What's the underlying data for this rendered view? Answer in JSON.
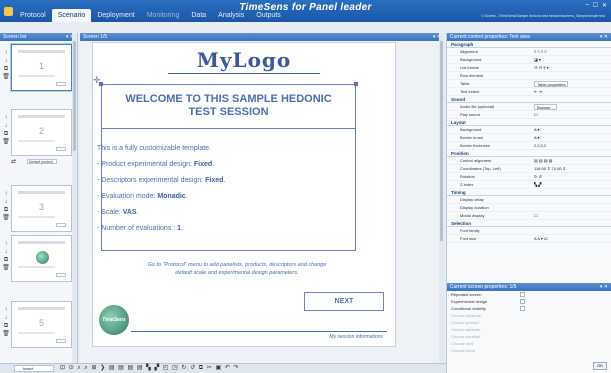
{
  "window": {
    "title": "TimeSens for Panel leader",
    "path": "C:\\Users\\...\\TimeSens\\Sample hedonic test session\\screens_Sample\\ample test"
  },
  "tabs": [
    {
      "label": "Protocol",
      "state": "normal"
    },
    {
      "label": "Scenario",
      "state": "active"
    },
    {
      "label": "Deployment",
      "state": "normal"
    },
    {
      "label": "Monitoring",
      "state": "disabled"
    },
    {
      "label": "Data",
      "state": "normal"
    },
    {
      "label": "Analysis",
      "state": "normal"
    },
    {
      "label": "Outputs",
      "state": "normal"
    }
  ],
  "screen_list": {
    "title": "Screen list",
    "items": [
      {
        "num": "1"
      },
      {
        "num": "2",
        "product_label": "Default product"
      },
      {
        "num": "3",
        "product_label": "Default product"
      },
      {
        "num": ""
      },
      {
        "num": "5"
      }
    ]
  },
  "screen": {
    "title": "Screen 1/5",
    "logo": "MyLogo",
    "welcome_line1": "WELCOME TO THIS SAMPLE HEDONIC",
    "welcome_line2": "TEST SESSION",
    "intro": "This is a fully customizable template.",
    "lines": [
      {
        "label": "- Product experimental design: ",
        "value": "Fixed",
        "end": "."
      },
      {
        "label": "- Descriptors experimental design: ",
        "value": "Fixed",
        "end": "."
      },
      {
        "label": "- Evaluation mode: ",
        "value": "Monadic",
        "end": "."
      },
      {
        "label": "- Scale: ",
        "value": "VAS",
        "end": "."
      },
      {
        "label": "- Number of evaluations : ",
        "value": "1",
        "end": "."
      }
    ],
    "hint_line1": "Go to \"Protocol\" menu to add panelists, products, descriptors and change",
    "hint_line2": "default scale and experimental design parameters.",
    "next_label": "NEXT",
    "footer": "My session informations",
    "sig": "TimeSens"
  },
  "control_props": {
    "title": "Current control properties: Text area",
    "sections": [
      {
        "name": "Paragraph",
        "rows": [
          {
            "label": "Alignment",
            "value": "≡ ≡ ≡ ≡"
          },
          {
            "label": "Background",
            "value": "◪ ▾"
          },
          {
            "label": "List format",
            "value": "☷ ☷ ¶ ▾"
          },
          {
            "label": "Row element",
            "value": ""
          },
          {
            "label": "Table",
            "value": "Table properties",
            "box": true
          },
          {
            "label": "Text indent",
            "value": "⇤ ⇥"
          }
        ]
      },
      {
        "name": "Sound",
        "rows": [
          {
            "label": "Audio file (optional)",
            "value": "Browse...",
            "box": true
          },
          {
            "label": "Play sound",
            "value": "☐"
          }
        ]
      },
      {
        "name": "Layout",
        "rows": [
          {
            "label": "Background",
            "value": "A ▾"
          },
          {
            "label": "Border brush",
            "value": "A ▾"
          },
          {
            "label": "Border thickness",
            "value": "2,2,2,2"
          }
        ]
      },
      {
        "name": "Position",
        "rows": [
          {
            "label": "Control alignment",
            "value": "▤ ▤ ▤ ▤"
          },
          {
            "label": "Coordinates (Top, Left)",
            "value": "116.00 ⇕  74.00 ⇕"
          },
          {
            "label": "Rotation",
            "value": "↻ ↺"
          },
          {
            "label": "Z-index",
            "value": "▚ ▞"
          }
        ]
      },
      {
        "name": "Timing",
        "rows": [
          {
            "label": "Display delay",
            "value": ""
          },
          {
            "label": "Display duration",
            "value": ""
          },
          {
            "label": "Modal display",
            "value": "☐"
          }
        ]
      },
      {
        "name": "Selection",
        "rows": [
          {
            "label": "Font family",
            "value": ""
          },
          {
            "label": "Font size",
            "value": "A A ▾ ☑"
          }
        ]
      }
    ]
  },
  "screen_props": {
    "title": "Current screen properties: 1/5",
    "rows": [
      {
        "label": "Repeated screen",
        "enabled": true
      },
      {
        "label": "Experimental design",
        "enabled": true
      },
      {
        "label": "Conditional visibility",
        "enabled": true
      },
      {
        "label": "Choose replicate",
        "enabled": false
      },
      {
        "label": "Choose product",
        "enabled": false
      },
      {
        "label": "Choose attribute",
        "enabled": false
      },
      {
        "label": "Choose panelist",
        "enabled": false
      },
      {
        "label": "Choose rank",
        "enabled": false
      },
      {
        "label": "Choose block",
        "enabled": false
      }
    ],
    "ok_label": "OK"
  },
  "toolbar": {
    "insert_label": "Insert",
    "icons": "⊡ ⊙ ⌕ ⌕ ⊞ ❯ ▤ ▤ ▤ ▤ ▚ ▞ ◰ ◳ ↻ ↺ ⧉ ✂ ▣ ↶ ↷"
  },
  "colors": {
    "accent": "#1a56a6",
    "text_blue": "#4a70b0"
  }
}
